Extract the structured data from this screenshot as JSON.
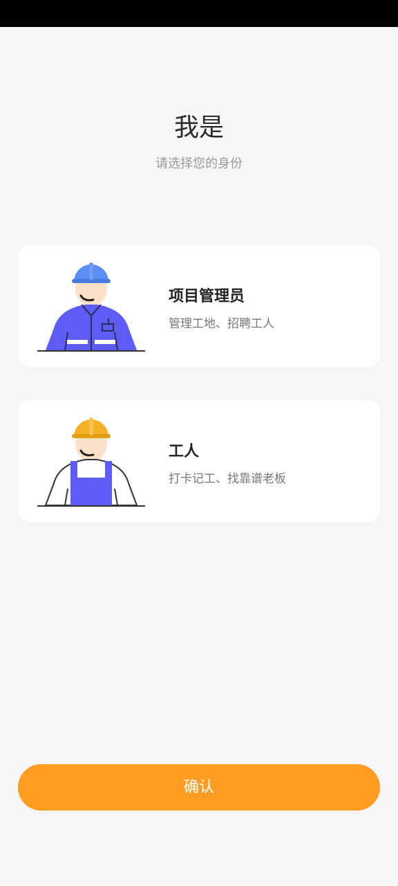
{
  "header": {
    "title": "我是",
    "subtitle": "请选择您的身份"
  },
  "roles": [
    {
      "title": "项目管理员",
      "description": "管理工地、招聘工人",
      "icon": "project-manager-icon",
      "helmet_color": "#5b8ef5",
      "uniform_color": "#5d5cf4"
    },
    {
      "title": "工人",
      "description": "打卡记工、找靠谱老板",
      "icon": "worker-icon",
      "helmet_color": "#f5b127",
      "uniform_color": "#5d5cf4"
    }
  ],
  "footer": {
    "confirm_label": "确认"
  },
  "colors": {
    "accent": "#ff9d22",
    "background": "#f6f6f6",
    "card": "#ffffff"
  }
}
